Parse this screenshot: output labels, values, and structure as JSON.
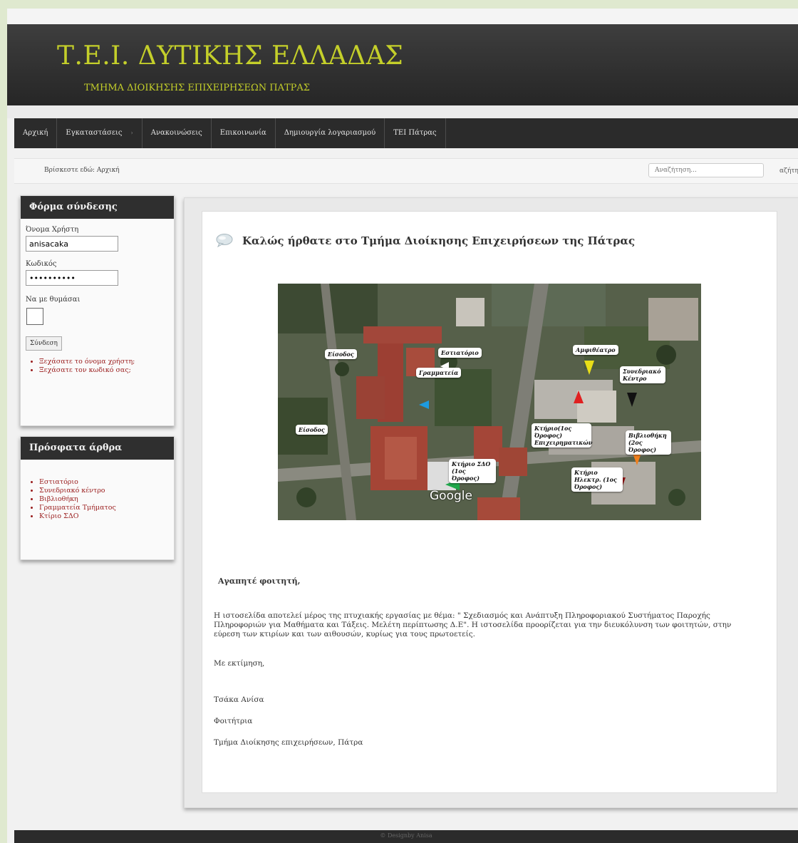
{
  "header": {
    "title": "Τ.Ε.Ι. ΔΥΤΙΚΗΣ ΕΛΛΑΔΑΣ",
    "subtitle": "ΤΜΗΜΑ ΔΙΟΙΚΗΣΗΣ ΕΠΙΧΕΙΡΗΣΕΩΝ ΠΑΤΡΑΣ"
  },
  "nav": {
    "items": [
      {
        "label": "Αρχική"
      },
      {
        "label": "Εγκαταστάσεις",
        "arrow": "›"
      },
      {
        "label": "Ανακοινώσεις"
      },
      {
        "label": "Επικοινωνία"
      },
      {
        "label": "Δημιουργία λογαριασμού"
      },
      {
        "label": "ΤΕΙ Πάτρας"
      }
    ]
  },
  "breadcrumb": "Βρίσκεστε εδώ: Αρχική",
  "search": {
    "placeholder": "Αναζήτηση...",
    "button_label": "αζήτη"
  },
  "login": {
    "title": "Φόρμα σύνδεσης",
    "username_label": "Όνομα Χρήστη",
    "username_value": "anisacaka",
    "password_label": "Κωδικός",
    "password_value": "••••••••••",
    "remember_label": "Να με θυμάσαι",
    "submit_label": "Σύνδεση",
    "links": [
      "Ξεχάσατε το όνομα χρήστη;",
      "Ξεχάσατε τον κωδικό σας;"
    ]
  },
  "recent": {
    "title": "Πρόσφατα άρθρα",
    "items": [
      "Εστιατόριο",
      "Συνεδριακό κέντρο",
      "Βιβλιοθήκη",
      "Γραμματεία Τμήματος",
      "Κτίριο ΣΔΟ"
    ]
  },
  "article": {
    "title": "Καλώς ήρθατε στο Τμήμα Διοίκησης Επιχειρήσεων της Πάτρας",
    "greeting": "Αγαπητέ φοιτητή,",
    "body": "Η ιστοσελίδα αποτελεί μέρος της πτυχιακής εργασίας με θέμα: \" Σχεδιασμός και Ανάπτυξη Πληροφοριακού Συστήματος Παροχής Πληροφοριών για Μαθήματα και Τάξεις. Μελέτη περίπτωσης Δ.Ε\". Η ιστοσελίδα προορίζεται για την διευκόλυνση των φοιτητών, στην εύρεση των κτιρίων και των αιθουσών, κυρίως για τους πρωτοετείς.",
    "closing": "Με εκτίμηση,",
    "signature_name": "Τσάκα Ανίσα",
    "signature_role": "Φοιτήτρια",
    "signature_dept": "Τμήμα Διοίκησης επιχειρήσεων, Πάτρα"
  },
  "map": {
    "labels": {
      "eisodos1": "Είσοδος",
      "estiatorio": "Εστιατόριο",
      "grammateia": "Γραμματεία",
      "amfitheatro": "Αμφιθέατρο",
      "synedriako": "Συνεδριακό Κέντρο",
      "eisodos2": "Είσοδος",
      "ktirio_dioik": "Κτήριο(1ος Όροφος) Επιχειρηματικών",
      "vivliothiki": "Βιβλιοθήκη (2ος Όροφος)",
      "ktirio_sdo": "Κτήριο ΣΔΟ (1ος Όροφος)",
      "ktirio_ilektr": "Κτήριο Ηλεκτρ. (1ος Όροφος)"
    },
    "watermark": "Google"
  },
  "footer": "© Designby Anisa",
  "colors": {
    "accent": "#c4cf2a",
    "link": "#9a1d1d",
    "nav_bg": "#2b2b2b"
  }
}
